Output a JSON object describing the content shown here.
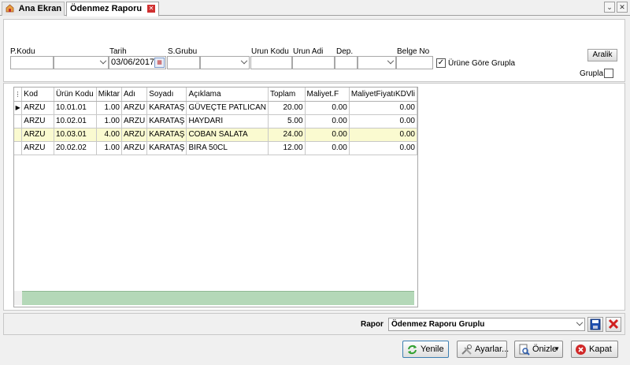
{
  "tabs": [
    {
      "label": "Ana Ekran"
    },
    {
      "label": "Ödenmez Raporu"
    }
  ],
  "filters": {
    "pkodu_label": "P.Kodu",
    "tarih_label": "Tarih",
    "tarih_value": "03/06/2017",
    "sgrubu_label": "S.Grubu",
    "urun_kodu_label": "Urun Kodu",
    "urun_adi_label": "Urun Adi",
    "dep_label": "Dep.",
    "belge_no_label": "Belge No",
    "urune_gore_grupla_label": "Ürüne Göre Grupla",
    "urune_gore_grupla_checked": true,
    "aralik_label": "Aralik",
    "grupla_label": "Grupla",
    "grupla_checked": false
  },
  "grid": {
    "columns": [
      "Kod",
      "Ürün Kodu",
      "Miktar",
      "Adı",
      "Soyadı",
      "Açıklama",
      "Toplam",
      "Maliyet.F",
      "MaliyetFiyatıKDVli"
    ],
    "rows": [
      [
        "ARZU",
        "10.01.01",
        "1.00",
        "ARZU",
        "KARATAŞ",
        "GÜVEÇTE PATLICAN",
        "20.00",
        "0.00",
        "0.00"
      ],
      [
        "ARZU",
        "10.02.01",
        "1.00",
        "ARZU",
        "KARATAŞ",
        "HAYDARI",
        "5.00",
        "0.00",
        "0.00"
      ],
      [
        "ARZU",
        "10.03.01",
        "4.00",
        "ARZU",
        "KARATAŞ",
        "COBAN SALATA",
        "24.00",
        "0.00",
        "0.00"
      ],
      [
        "ARZU",
        "20.02.02",
        "1.00",
        "ARZU",
        "KARATAŞ",
        "BIRA 50CL",
        "12.00",
        "0.00",
        "0.00"
      ]
    ],
    "selected_row": 2,
    "current_row": 0,
    "footer_color": "#b4d8b8"
  },
  "report": {
    "label": "Rapor",
    "selected": "Ödenmez Raporu Gruplu"
  },
  "buttons": {
    "yenile": "Yenile",
    "ayarlar": "Ayarlar...",
    "onizle": "Önizle",
    "kapat": "Kapat"
  }
}
